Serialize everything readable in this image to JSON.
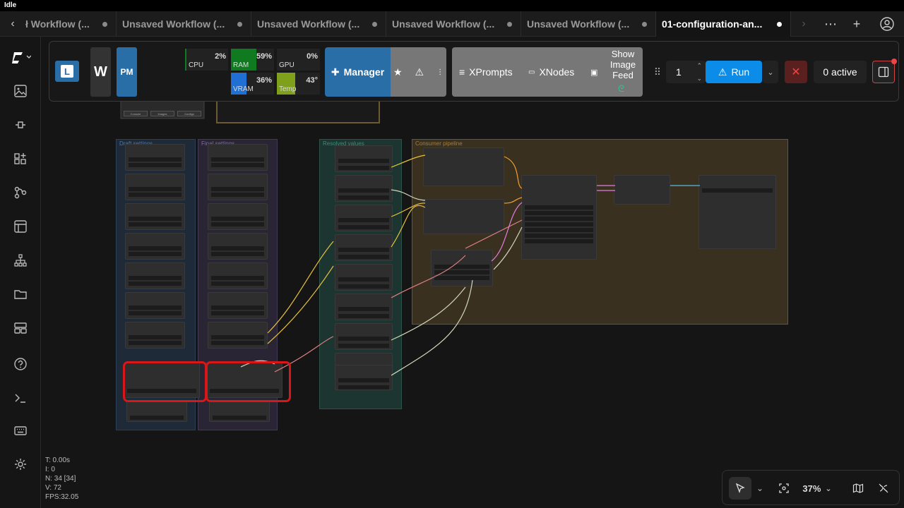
{
  "window_title": "Idle",
  "tabs": [
    {
      "label": "ł Workflow (..."
    },
    {
      "label": "Unsaved Workflow (..."
    },
    {
      "label": "Unsaved Workflow (..."
    },
    {
      "label": "Unsaved Workflow (..."
    },
    {
      "label": "Unsaved Workflow (..."
    },
    {
      "label": "01-configuration-an...",
      "active": true
    }
  ],
  "toolbar": {
    "app_l": "L",
    "app_w": "W",
    "app_pm": "PM",
    "monitors": {
      "cpu": {
        "label": "CPU",
        "value": "2%"
      },
      "ram": {
        "label": "RAM",
        "value": "59%"
      },
      "gpu": {
        "label": "GPU",
        "value": "0%"
      },
      "vram": {
        "label": "VRAM",
        "value": "36%"
      },
      "temp": {
        "label": "Temp",
        "value": "43°"
      }
    },
    "manager_label": "Manager",
    "xprompts_label": "XPrompts",
    "xnodes_label": "XNodes",
    "show_image_feed_label": "Show Image Feed",
    "queue_count": "1",
    "run_label": "Run",
    "active_label": "0 active"
  },
  "canvas": {
    "groups": {
      "draft": "Draft settings",
      "final": "Final settings",
      "resolved": "Resolved values",
      "consumer": "Consumer pipeline"
    },
    "mini_buttons": [
      "Console",
      "Images",
      "Configs"
    ]
  },
  "stats": {
    "t": "T: 0.00s",
    "i": "I: 0",
    "n": "N: 34 [34]",
    "v": "V: 72",
    "fps": "FPS:32.05"
  },
  "bottombar": {
    "zoom": "37%"
  },
  "colors": {
    "run": "#0b8ce9",
    "manager": "#2a6ea8",
    "pm": "#2a6ea8",
    "ram": "#0f7a1f",
    "vram": "#1f6fd4",
    "temp": "#7fa01a",
    "highlight": "#d81818"
  }
}
